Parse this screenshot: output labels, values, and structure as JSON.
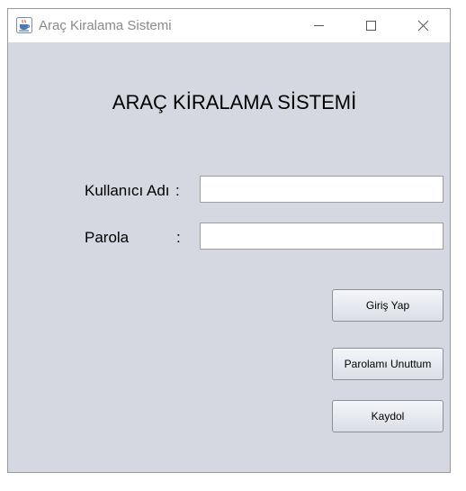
{
  "window": {
    "title": "Araç Kiralama Sistemi",
    "icon": "java-cup-icon",
    "controls": [
      "minimize-icon",
      "maximize-icon",
      "close-icon"
    ]
  },
  "form": {
    "heading": "ARAÇ KİRALAMA SİSTEMİ",
    "username_label": "Kullanıcı Adı",
    "password_label": "Parola",
    "colon": ":",
    "username_value": "",
    "password_value": ""
  },
  "buttons": {
    "login": "Giriş Yap",
    "forgot_password": "Parolamı Unuttum",
    "register": "Kaydol"
  },
  "colors": {
    "content_background": "#d5d8e0",
    "titlebar_background": "#ffffff",
    "title_text": "#8a8a8a"
  }
}
